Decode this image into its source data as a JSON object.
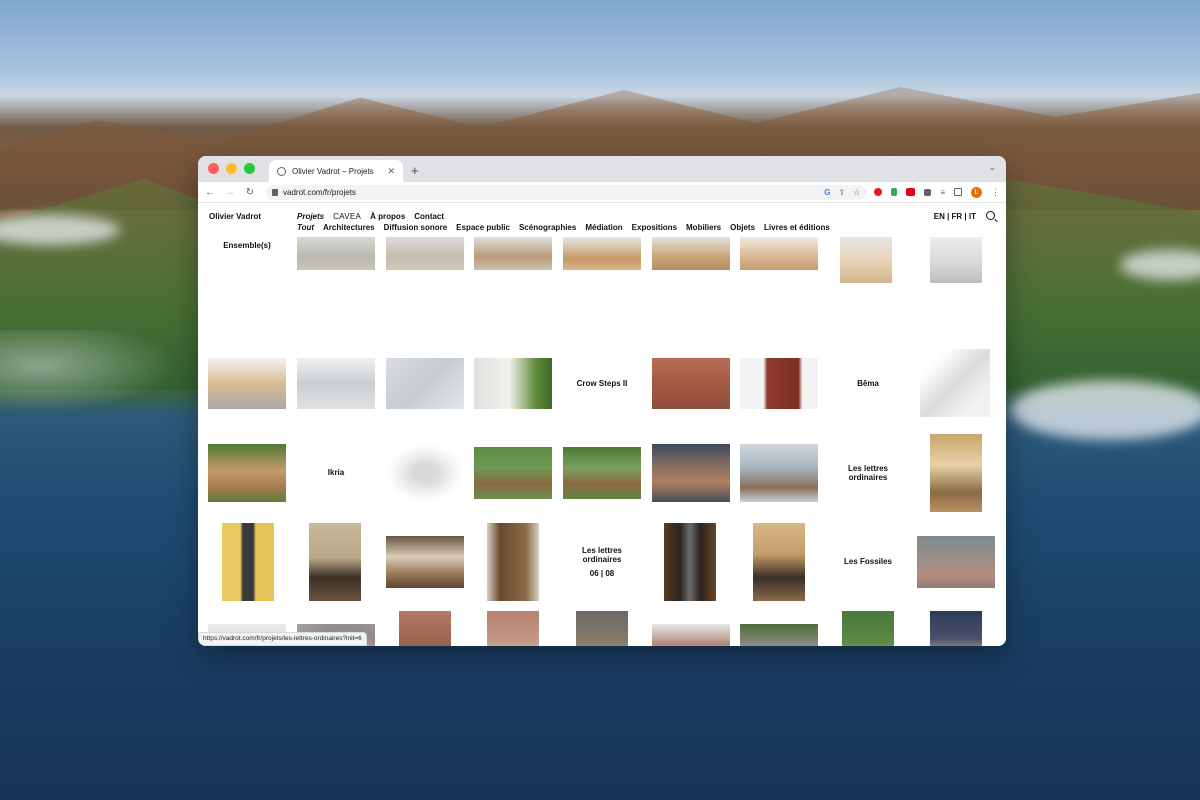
{
  "browser": {
    "tab_title": "Olivier Vadrot – Projets",
    "url": "vadrot.com/fr/projets",
    "avatar_letter": "L",
    "status_url": "https://vadrot.com/fr/projets/les-lettres-ordinaires?init=6"
  },
  "site": {
    "name": "Olivier Vadrot",
    "nav_main": [
      "Projets",
      "CAVEA",
      "À propos",
      "Contact"
    ],
    "nav_sub": [
      "Tout",
      "Architectures",
      "Diffusion sonore",
      "Espace public",
      "Scénographies",
      "Médiation",
      "Expositions",
      "Mobiliers",
      "Objets",
      "Livres et éditions"
    ],
    "lang": "EN | FR | IT"
  },
  "labels": {
    "ensembles": "Ensemble(s)",
    "crow_steps": "Crow Steps II",
    "bema": "Bēma",
    "ikria": "Ikria",
    "lettres_1": "Les lettres ordinaires",
    "lettres_2": "Les lettres ordinaires",
    "lettres_counter": "06 | 08",
    "fossiles": "Les Fossiles"
  },
  "colors": {
    "window_bg": "#ffffff",
    "tabbar_bg": "#dfe1e5",
    "text": "#111111"
  }
}
